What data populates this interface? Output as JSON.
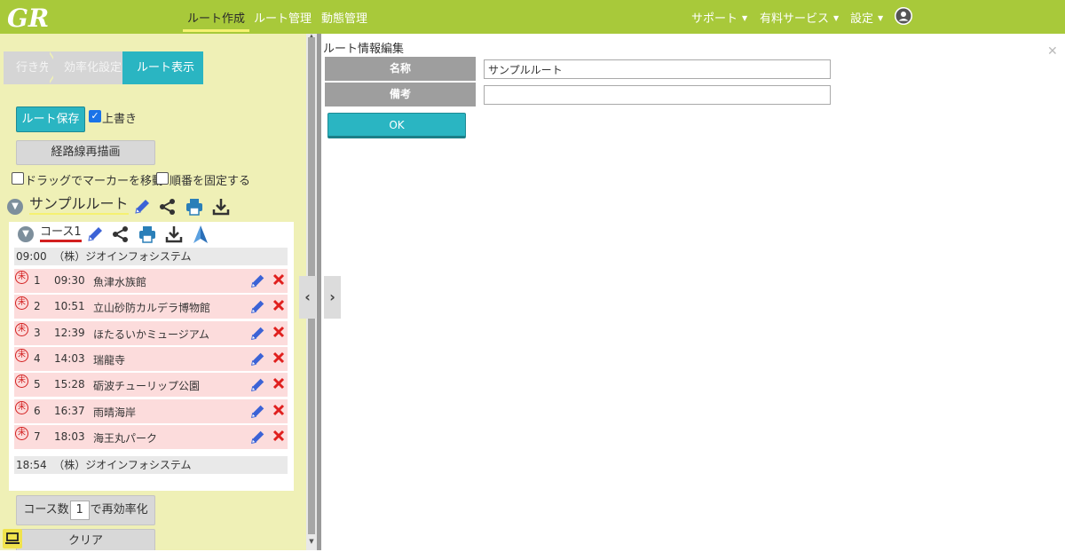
{
  "nav": {
    "logo_text": "GR",
    "items": [
      "ルート作成",
      "ルート管理",
      "動態管理"
    ],
    "active_index": 0,
    "right": [
      "サポート",
      "有料サービス",
      "設定"
    ]
  },
  "breadcrumb": [
    "行き先",
    "効率化設定",
    "ルート表示"
  ],
  "left": {
    "save_label": "ルート保存",
    "overwrite_label": "上書き",
    "overwrite_checked": true,
    "redraw_label": "経路線再描画",
    "drag_label": "ドラッグでマーカーを移動",
    "fix_order_label": "順番を固定する",
    "route_name": "サンプルルート",
    "course_name": "コース1",
    "start": {
      "time": "09:00",
      "name": "（株）ジオインフォシステム"
    },
    "end": {
      "time": "18:54",
      "name": "（株）ジオインフォシステム"
    },
    "stops": [
      {
        "num": "1",
        "time": "09:30",
        "name": "魚津水族館"
      },
      {
        "num": "2",
        "time": "10:51",
        "name": "立山砂防カルデラ博物館"
      },
      {
        "num": "3",
        "time": "12:39",
        "name": "ほたるいかミュージアム"
      },
      {
        "num": "4",
        "time": "14:03",
        "name": "瑞龍寺"
      },
      {
        "num": "5",
        "time": "15:28",
        "name": "砺波チューリップ公園"
      },
      {
        "num": "6",
        "time": "16:37",
        "name": "雨晴海岸"
      },
      {
        "num": "7",
        "time": "18:03",
        "name": "海王丸パーク"
      }
    ],
    "stop_badge": "未",
    "course_count_prefix": "コース数",
    "course_count_value": "1",
    "course_count_suffix": "で再効率化",
    "clear_label": "クリア"
  },
  "form": {
    "title": "ルート情報編集",
    "name_label": "名称",
    "name_value": "サンプルルート",
    "note_label": "備考",
    "note_value": "",
    "ok_label": "OK"
  },
  "colors": {
    "topbar": "#a8c93a",
    "left_panel": "#eff0b6",
    "accent": "#2ab5c2",
    "stop_row": "#fcdcdc"
  }
}
